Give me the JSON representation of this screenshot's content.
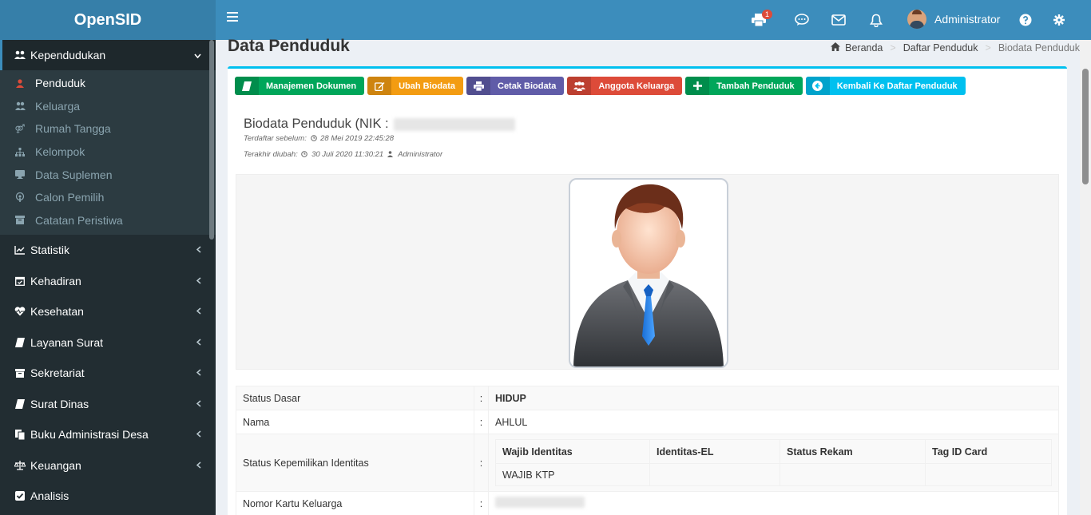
{
  "app": {
    "name": "OpenSID"
  },
  "sidebar": {
    "items": [
      {
        "label": "Kependudukan",
        "icon": "users-icon",
        "expanded": true
      },
      {
        "label": "Statistik",
        "icon": "chart-icon"
      },
      {
        "label": "Kehadiran",
        "icon": "calendar-check-icon"
      },
      {
        "label": "Kesehatan",
        "icon": "heartbeat-icon"
      },
      {
        "label": "Layanan Surat",
        "icon": "book-icon"
      },
      {
        "label": "Sekretariat",
        "icon": "archive-icon"
      },
      {
        "label": "Surat Dinas",
        "icon": "book-icon"
      },
      {
        "label": "Buku Administrasi Desa",
        "icon": "copy-icon"
      },
      {
        "label": "Keuangan",
        "icon": "balance-scale-icon"
      },
      {
        "label": "Analisis",
        "icon": "check-square-icon"
      }
    ],
    "submenu": [
      {
        "label": "Penduduk",
        "icon": "user-icon",
        "active": true
      },
      {
        "label": "Keluarga",
        "icon": "users-icon"
      },
      {
        "label": "Rumah Tangga",
        "icon": "venus-mars-icon"
      },
      {
        "label": "Kelompok",
        "icon": "sitemap-icon"
      },
      {
        "label": "Data Suplemen",
        "icon": "desktop-icon"
      },
      {
        "label": "Calon Pemilih",
        "icon": "podcast-icon"
      },
      {
        "label": "Catatan Peristiwa",
        "icon": "archive-icon"
      }
    ]
  },
  "topbar": {
    "print_badge": "1",
    "user_name": "Administrator"
  },
  "page": {
    "title": "Data Penduduk",
    "breadcrumb": [
      "Beranda",
      "Daftar Penduduk",
      "Biodata Penduduk"
    ]
  },
  "buttons": [
    {
      "label": "Manajemen Dokumen",
      "color": "#00a65a",
      "icon": "book-icon"
    },
    {
      "label": "Ubah Biodata",
      "color": "#f39c12",
      "icon": "edit-icon"
    },
    {
      "label": "Cetak Biodata",
      "color": "#605ca8",
      "icon": "print-icon"
    },
    {
      "label": "Anggota Keluarga",
      "color": "#dd4b39",
      "icon": "users-icon"
    },
    {
      "label": "Tambah Penduduk",
      "color": "#00a65a",
      "icon": "plus-icon"
    },
    {
      "label": "Kembali Ke Daftar Penduduk",
      "color": "#00c0ef",
      "icon": "arrow-left-circle-icon"
    }
  ],
  "biodata": {
    "title_prefix": "Biodata Penduduk (NIK :",
    "registered_label": "Terdaftar sebelum:",
    "registered_date": "28 Mei 2019 22:45:28",
    "updated_label": "Terakhir diubah:",
    "updated_date": "30 Juli 2020 11:30:21",
    "updated_by": "Administrator"
  },
  "details": {
    "status_dasar_label": "Status Dasar",
    "status_dasar_value": "HIDUP",
    "nama_label": "Nama",
    "nama_value": "AHLUL",
    "kepemilikan_label": "Status Kepemilikan Identitas",
    "identitas_headers": [
      "Wajib Identitas",
      "Identitas-EL",
      "Status Rekam",
      "Tag ID Card"
    ],
    "identitas_row": [
      "WAJIB KTP",
      "",
      "",
      ""
    ],
    "kk_label": "Nomor Kartu Keluarga",
    "colon": ":"
  }
}
